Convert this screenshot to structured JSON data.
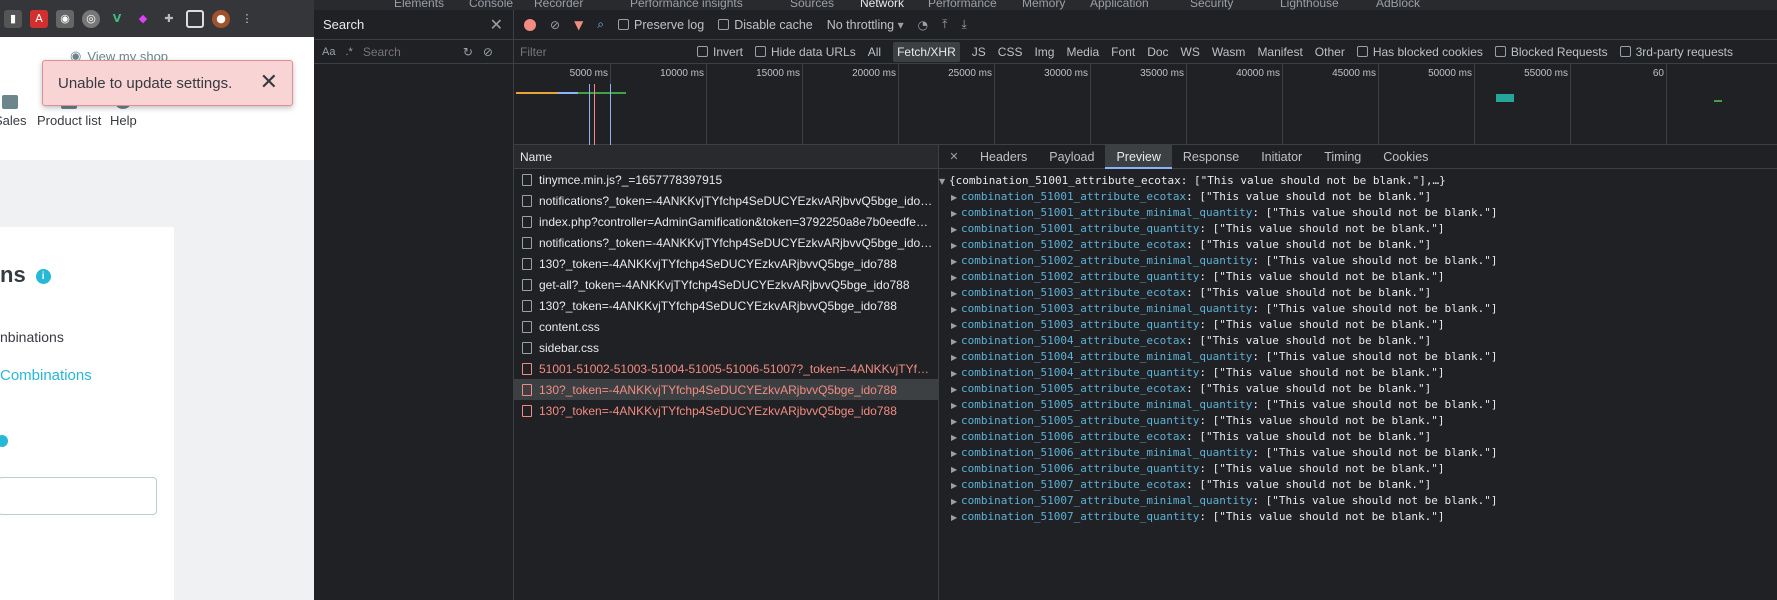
{
  "page": {
    "view_shop": "View my shop",
    "nav": [
      {
        "label": "Sales"
      },
      {
        "label": "Product list"
      },
      {
        "label": "Help"
      }
    ],
    "toast": {
      "message": "Unable to update settings.",
      "close": "✕"
    },
    "card": {
      "title": "ns",
      "subtitle": "nbinations",
      "link": "Combinations"
    }
  },
  "devtools": {
    "tabs": [
      "Elements",
      "Console",
      "Recorder",
      "Performance insights",
      "Sources",
      "Network",
      "Performance",
      "Memory",
      "Application",
      "Security",
      "Lighthouse",
      "AdBlock"
    ],
    "active_tab": "Network",
    "search": {
      "title": "Search",
      "case_label": "Aa",
      "regex_label": ".*",
      "placeholder": "Search"
    },
    "toolbar": {
      "preserve_log": "Preserve log",
      "disable_cache": "Disable cache",
      "throttling": "No throttling"
    },
    "filter": {
      "placeholder": "Filter",
      "invert": "Invert",
      "hide_data_urls": "Hide data URLs",
      "types": [
        "All",
        "Fetch/XHR",
        "JS",
        "CSS",
        "Img",
        "Media",
        "Font",
        "Doc",
        "WS",
        "Wasm",
        "Manifest",
        "Other"
      ],
      "active_type": "Fetch/XHR",
      "has_blocked_cookies": "Has blocked cookies",
      "blocked_requests": "Blocked Requests",
      "third_party": "3rd-party requests"
    },
    "timeline_ticks": [
      "5000 ms",
      "10000 ms",
      "15000 ms",
      "20000 ms",
      "25000 ms",
      "30000 ms",
      "35000 ms",
      "40000 ms",
      "45000 ms",
      "50000 ms",
      "55000 ms",
      "60"
    ],
    "requests": {
      "header": "Name",
      "rows": [
        {
          "name": "tinymce.min.js?_=1657778397915",
          "status": "ok"
        },
        {
          "name": "notifications?_token=-4ANKKvjTYfchp4SeDUCYEzkvARjbvvQ5bge_ido788&rand=…",
          "status": "ok"
        },
        {
          "name": "index.php?controller=AdminGamification&token=3792250a8e7b0eedfe…",
          "status": "ok"
        },
        {
          "name": "notifications?_token=-4ANKKvjTYfchp4SeDUCYEzkvARjbvvQ5bge_ido788&rand=…",
          "status": "ok"
        },
        {
          "name": "130?_token=-4ANKKvjTYfchp4SeDUCYEzkvARjbvvQ5bge_ido788",
          "status": "ok"
        },
        {
          "name": "get-all?_token=-4ANKKvjTYfchp4SeDUCYEzkvARjbvvQ5bge_ido788",
          "status": "ok"
        },
        {
          "name": "130?_token=-4ANKKvjTYfchp4SeDUCYEzkvARjbvvQ5bge_ido788",
          "status": "ok"
        },
        {
          "name": "content.css",
          "status": "ok"
        },
        {
          "name": "sidebar.css",
          "status": "ok"
        },
        {
          "name": "51001-51002-51003-51004-51005-51006-51007?_token=-4ANKKvjTYfchp4SeDUC…",
          "status": "error"
        },
        {
          "name": "130?_token=-4ANKKvjTYfchp4SeDUCYEzkvARjbvvQ5bge_ido788",
          "status": "error-selected"
        },
        {
          "name": "130?_token=-4ANKKvjTYfchp4SeDUCYEzkvARjbvvQ5bge_ido788",
          "status": "error"
        }
      ]
    },
    "detail_tabs": [
      "Headers",
      "Payload",
      "Preview",
      "Response",
      "Initiator",
      "Timing",
      "Cookies"
    ],
    "active_detail_tab": "Preview",
    "preview": {
      "summary": "{combination_51001_attribute_ecotax: [\"This value should not be blank.\"],…}",
      "entries": [
        {
          "key": "combination_51001_attribute_ecotax",
          "value": "[\"This value should not be blank.\"]"
        },
        {
          "key": "combination_51001_attribute_minimal_quantity",
          "value": "[\"This value should not be blank.\"]"
        },
        {
          "key": "combination_51001_attribute_quantity",
          "value": "[\"This value should not be blank.\"]"
        },
        {
          "key": "combination_51002_attribute_ecotax",
          "value": "[\"This value should not be blank.\"]"
        },
        {
          "key": "combination_51002_attribute_minimal_quantity",
          "value": "[\"This value should not be blank.\"]"
        },
        {
          "key": "combination_51002_attribute_quantity",
          "value": "[\"This value should not be blank.\"]"
        },
        {
          "key": "combination_51003_attribute_ecotax",
          "value": "[\"This value should not be blank.\"]"
        },
        {
          "key": "combination_51003_attribute_minimal_quantity",
          "value": "[\"This value should not be blank.\"]"
        },
        {
          "key": "combination_51003_attribute_quantity",
          "value": "[\"This value should not be blank.\"]"
        },
        {
          "key": "combination_51004_attribute_ecotax",
          "value": "[\"This value should not be blank.\"]"
        },
        {
          "key": "combination_51004_attribute_minimal_quantity",
          "value": "[\"This value should not be blank.\"]"
        },
        {
          "key": "combination_51004_attribute_quantity",
          "value": "[\"This value should not be blank.\"]"
        },
        {
          "key": "combination_51005_attribute_ecotax",
          "value": "[\"This value should not be blank.\"]"
        },
        {
          "key": "combination_51005_attribute_minimal_quantity",
          "value": "[\"This value should not be blank.\"]"
        },
        {
          "key": "combination_51005_attribute_quantity",
          "value": "[\"This value should not be blank.\"]"
        },
        {
          "key": "combination_51006_attribute_ecotax",
          "value": "[\"This value should not be blank.\"]"
        },
        {
          "key": "combination_51006_attribute_minimal_quantity",
          "value": "[\"This value should not be blank.\"]"
        },
        {
          "key": "combination_51006_attribute_quantity",
          "value": "[\"This value should not be blank.\"]"
        },
        {
          "key": "combination_51007_attribute_ecotax",
          "value": "[\"This value should not be blank.\"]"
        },
        {
          "key": "combination_51007_attribute_minimal_quantity",
          "value": "[\"This value should not be blank.\"]"
        },
        {
          "key": "combination_51007_attribute_quantity",
          "value": "[\"This value should not be blank.\"]"
        }
      ]
    }
  }
}
